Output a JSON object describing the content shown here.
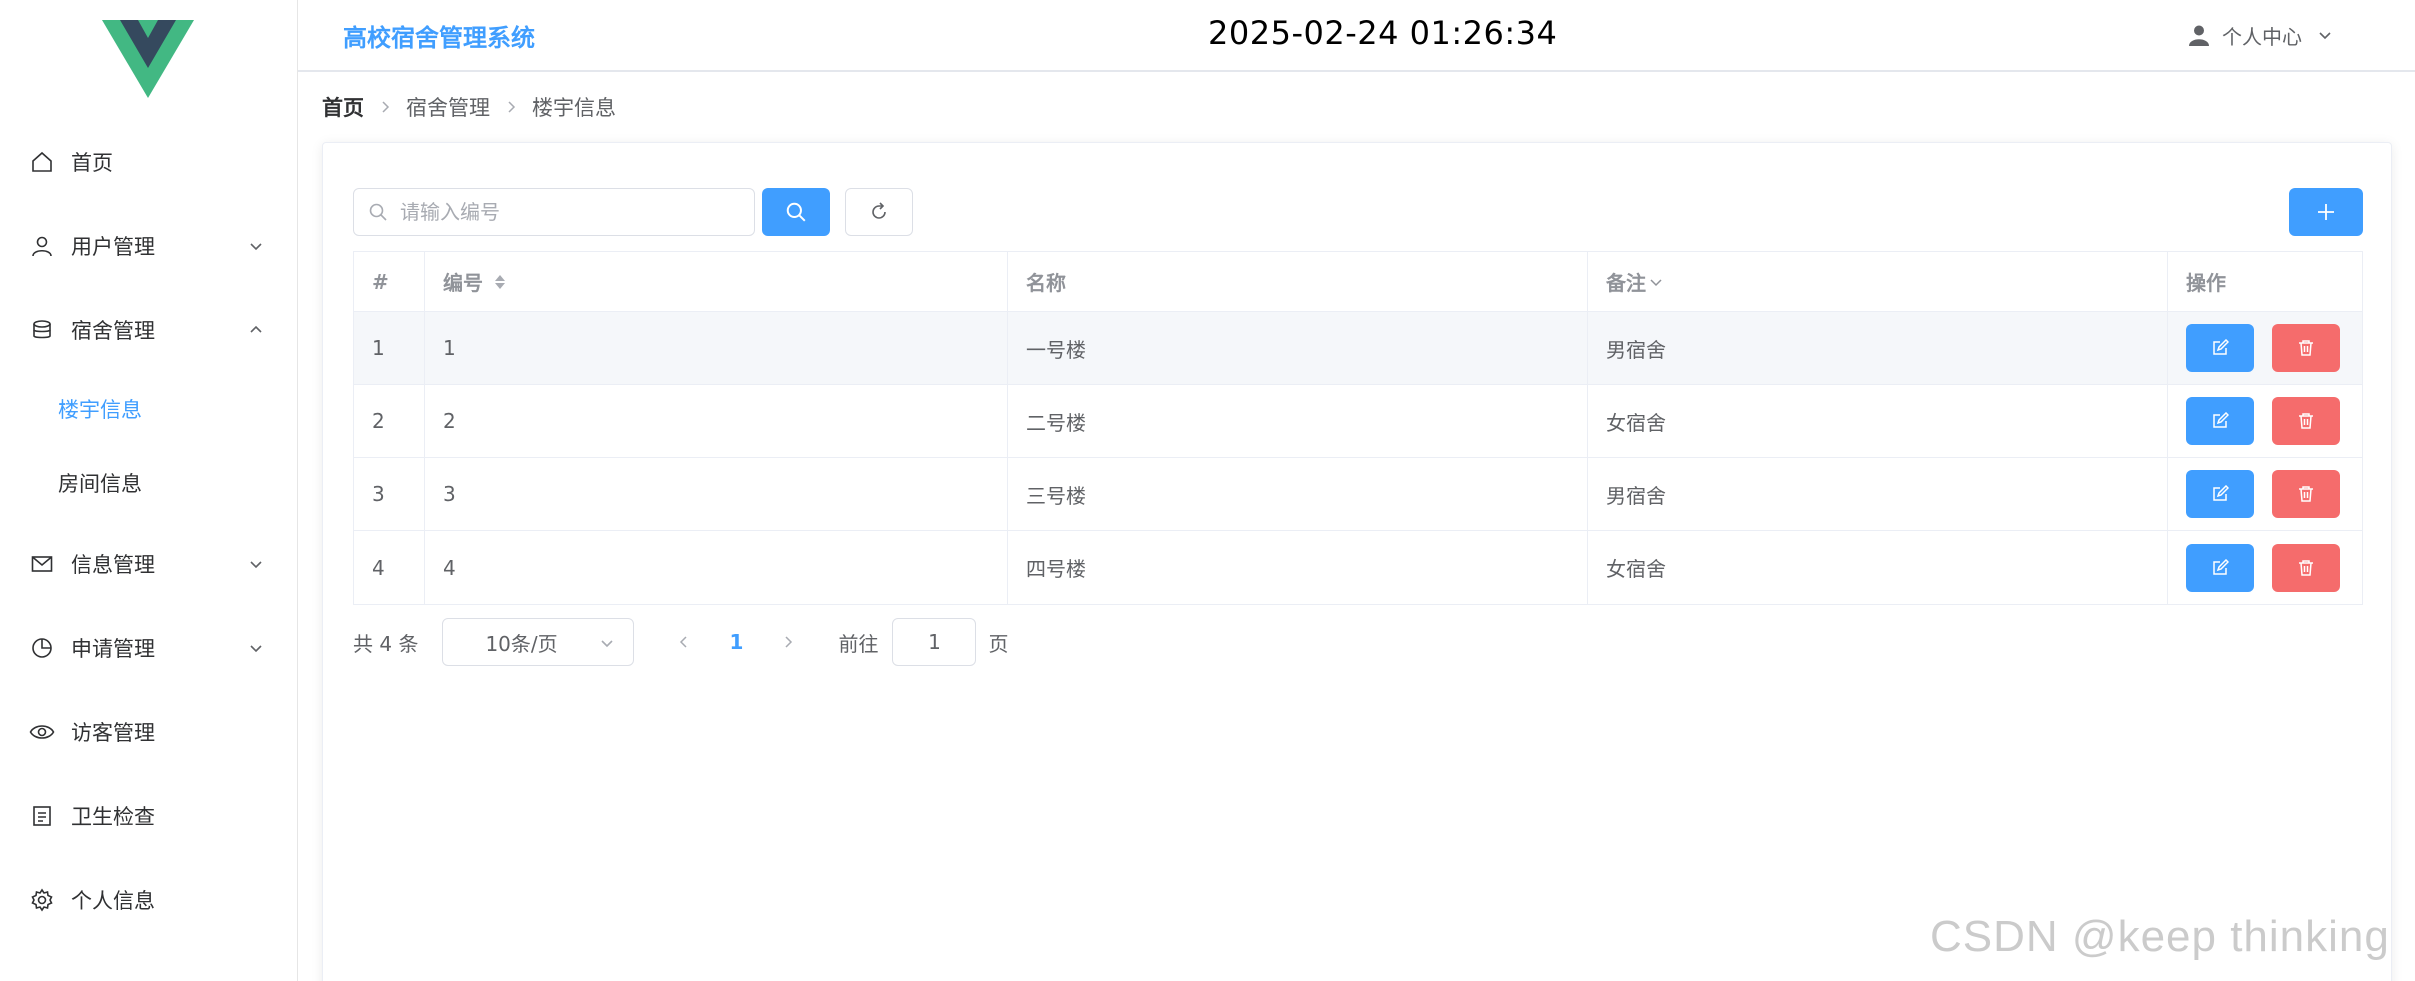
{
  "header": {
    "system_title": "高校宿舍管理系统",
    "clock": "2025-02-24 01:26:34",
    "user_center_label": "个人中心"
  },
  "sidebar": {
    "items": [
      {
        "label": "首页",
        "icon": "home-icon"
      },
      {
        "label": "用户管理",
        "icon": "user-icon",
        "expandable": true
      },
      {
        "label": "宿舍管理",
        "icon": "database-icon",
        "expandable": true,
        "expanded": true
      },
      {
        "label": "信息管理",
        "icon": "mail-icon",
        "expandable": true
      },
      {
        "label": "申请管理",
        "icon": "pie-chart-icon",
        "expandable": true
      },
      {
        "label": "访客管理",
        "icon": "eye-icon"
      },
      {
        "label": "卫生检查",
        "icon": "document-icon"
      },
      {
        "label": "个人信息",
        "icon": "gear-icon"
      }
    ],
    "submenu": [
      {
        "label": "楼宇信息",
        "active": true
      },
      {
        "label": "房间信息",
        "active": false
      }
    ]
  },
  "breadcrumb": [
    "首页",
    "宿舍管理",
    "楼宇信息"
  ],
  "toolbar": {
    "search_placeholder": "请输入编号",
    "search_value": ""
  },
  "table": {
    "columns": [
      "#",
      "编号",
      "名称",
      "备注",
      "操作"
    ],
    "rows": [
      {
        "index": "1",
        "code": "1",
        "name": "一号楼",
        "note": "男宿舍"
      },
      {
        "index": "2",
        "code": "2",
        "name": "二号楼",
        "note": "女宿舍"
      },
      {
        "index": "3",
        "code": "3",
        "name": "三号楼",
        "note": "男宿舍"
      },
      {
        "index": "4",
        "code": "4",
        "name": "四号楼",
        "note": "女宿舍"
      }
    ]
  },
  "pagination": {
    "total_text": "共 4 条",
    "page_size": "10条/页",
    "current_page": "1",
    "goto_label": "前往",
    "goto_value": "1",
    "page_unit": "页"
  },
  "watermark": "CSDN @keep   thinking",
  "colors": {
    "primary": "#409eff",
    "danger": "#f56c6c",
    "logo_green": "#42b883",
    "logo_dark": "#35495e"
  }
}
